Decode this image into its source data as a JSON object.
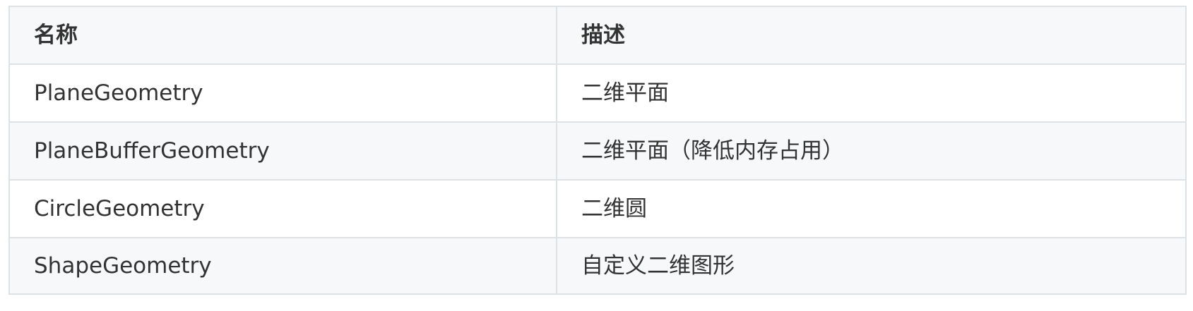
{
  "table": {
    "headers": [
      "名称",
      "描述"
    ],
    "rows": [
      [
        "PlaneGeometry",
        "二维平面"
      ],
      [
        "PlaneBufferGeometry",
        "二维平面（降低内存占用）"
      ],
      [
        "CircleGeometry",
        "二维圆"
      ],
      [
        "ShapeGeometry",
        "自定义二维图形"
      ]
    ]
  },
  "colors": {
    "border": "#dfe2e5",
    "header_bg": "#f6f8fa",
    "stripe_bg": "#f6f8fa",
    "text": "#333333"
  }
}
